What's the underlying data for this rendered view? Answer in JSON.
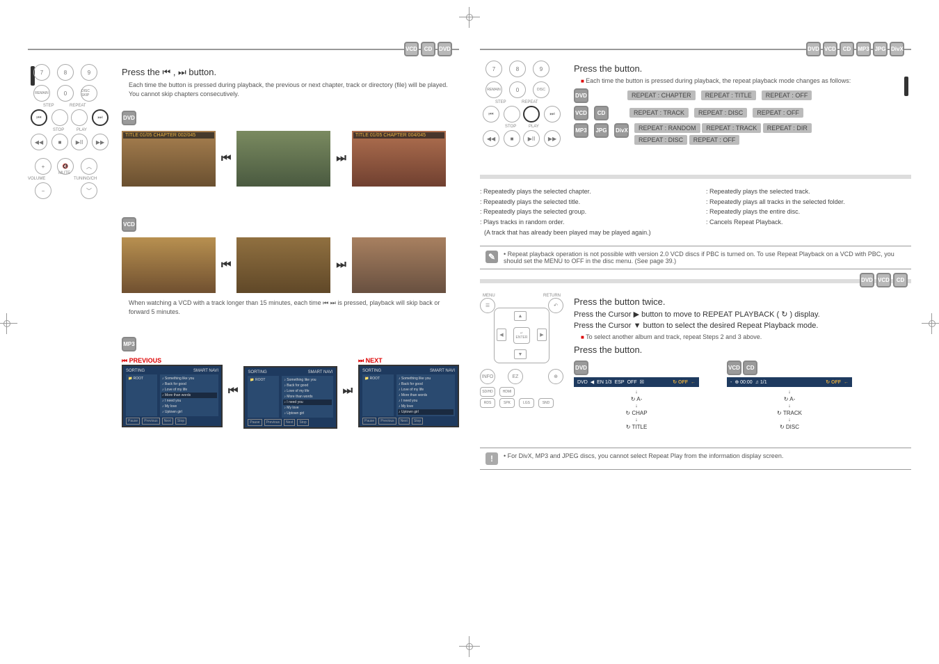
{
  "left": {
    "section_title": "Press the ⏮ , ⏭ button.",
    "desc1": "Each time the button is pressed during playback, the previous or next chapter, track or directory (file) will be played.",
    "desc2": "You cannot skip chapters consecutively.",
    "thumb_caption_prev": "TITLE 01/05 CHAPTER 002/045",
    "thumb_caption_next": "TITLE 01/05 CHAPTER 004/045",
    "vcd_note": "When watching a VCD with a track longer than 15 minutes, each time ⏮ ⏭ is pressed, playback will skip back or forward 5 minutes.",
    "fb_prev_label": "⏮ PREVIOUS",
    "fb_next_label": "⏭ NEXT",
    "fb_folder": "ROOT",
    "fb_files": [
      "Something like you",
      "Back for good",
      "Love of my life",
      "More than words",
      "I need you",
      "My love",
      "Uptown girl"
    ],
    "fb_sel_prev": "More than words",
    "fb_sel_mid": "I need you",
    "fb_sel_next": "Uptown girl",
    "fb_foot": [
      "Pause",
      "Previous",
      "Next",
      "Stop"
    ],
    "remote": {
      "step": "STEP",
      "repeat": "REPEAT",
      "stop": "STOP",
      "play": "PLAY",
      "mute": "MUTE",
      "volume": "VOLUME",
      "tuning": "TUNING/CH",
      "remain": "REMAIN",
      "disc": "DISC SKIP"
    }
  },
  "right": {
    "title1": "Press the            button.",
    "title1_desc": "Each time the button is pressed during playback, the repeat playback mode changes as follows:",
    "row1": [
      "REPEAT : CHAPTER",
      "REPEAT : TITLE",
      "REPEAT : OFF"
    ],
    "row2": [
      "REPEAT : TRACK",
      "REPEAT : DISC",
      "REPEAT : OFF"
    ],
    "row3a": [
      "REPEAT : RANDOM",
      "REPEAT : TRACK",
      "REPEAT : DIR"
    ],
    "row3b": [
      "REPEAT : DISC",
      "REPEAT : OFF"
    ],
    "defs_left": {
      "chapter": ": Repeatedly plays the selected chapter.",
      "title": ": Repeatedly plays the selected title.",
      "group": ": Repeatedly plays the selected group.",
      "random": ": Plays tracks in random order.",
      "random2": "(A track that has already been played may be played again.)"
    },
    "defs_right": {
      "track": ": Repeatedly plays the selected track.",
      "dir": ": Repeatedly plays all tracks in the selected folder.",
      "disc": ": Repeatedly plays the entire disc.",
      "off": ": Cancels Repeat Playback."
    },
    "note1": "• Repeat playback operation is not possible with version 2.0 VCD discs if PBC is turned on. To use Repeat Playback on a VCD with PBC, you should set the MENU to OFF in the disc menu. (See page 39.)",
    "step1": "Press the          button twice.",
    "step2": "Press the Cursor ▶ button to move to REPEAT PLAYBACK ( ↻ ) display.",
    "step3": "Press the Cursor ▼ button to select the desired Repeat Playback mode.",
    "step3_sub": "To select another album and track, repeat Steps 2 and 3 above.",
    "step4": "Press the            button.",
    "diag_left": {
      "bar_items": [
        "DVD",
        "◀",
        "EN 1/3",
        "ESP",
        "OFF",
        "☒"
      ],
      "off": "↻ OFF",
      "a": "↻ A-",
      "chap": "↻ CHAP",
      "title": "↻ TITLE"
    },
    "diag_right": {
      "bar_items": [
        "-",
        "⊕ 00:00",
        "♫ 1/1"
      ],
      "off": "↻ OFF",
      "a": "↻ A-",
      "track": "↻ TRACK",
      "disc": "↻ DISC"
    },
    "note2": "• For DivX, MP3 and JPEG discs, you cannot select Repeat Play from the information display screen.",
    "menu": "MENU",
    "return": "RETURN",
    "enter": "ENTER",
    "info": "INFO"
  }
}
